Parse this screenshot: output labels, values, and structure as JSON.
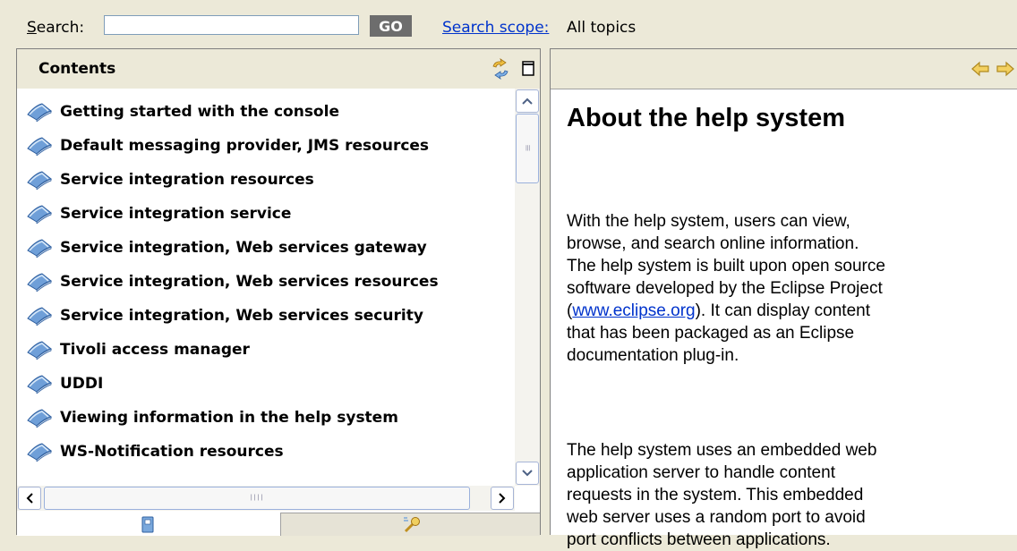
{
  "search": {
    "label_accel": "S",
    "label_rest": "earch:",
    "query": "",
    "go_label": "GO",
    "scope_link": "Search scope:",
    "scope_value": "All topics"
  },
  "contents": {
    "title": "Contents",
    "items": [
      {
        "label": "Getting started with the console"
      },
      {
        "label": "Default messaging provider, JMS resources"
      },
      {
        "label": "Service integration resources"
      },
      {
        "label": "Service integration service"
      },
      {
        "label": "Service integration, Web services gateway"
      },
      {
        "label": "Service integration, Web services resources"
      },
      {
        "label": "Service integration, Web services security"
      },
      {
        "label": "Tivoli access manager"
      },
      {
        "label": "UDDI"
      },
      {
        "label": "Viewing information in the help system"
      },
      {
        "label": "WS-Notification resources"
      }
    ],
    "tabs": [
      "contents-tab-icon",
      "search-results-tab-icon"
    ],
    "scroll_position_fraction": 0.0
  },
  "article": {
    "title": "About the help system",
    "p1_before": "With the help system, users can view,\nbrowse, and search online information.\nThe help system is built upon open source\nsoftware developed by the Eclipse Project\n(",
    "p1_link": "www.eclipse.org",
    "p1_after": "). It can display content\nthat has been packaged as an Eclipse\ndocumentation plug-in.",
    "p2": "The help system uses an embedded web\napplication server to handle content\nrequests in the system. This embedded\nweb server uses a random port to avoid\nport conflicts between applications."
  },
  "colors": {
    "chrome": "#ece9d8",
    "link": "#0033cc",
    "nav_arrow": "#f0c040",
    "book_blue": "#6f9fd8"
  }
}
